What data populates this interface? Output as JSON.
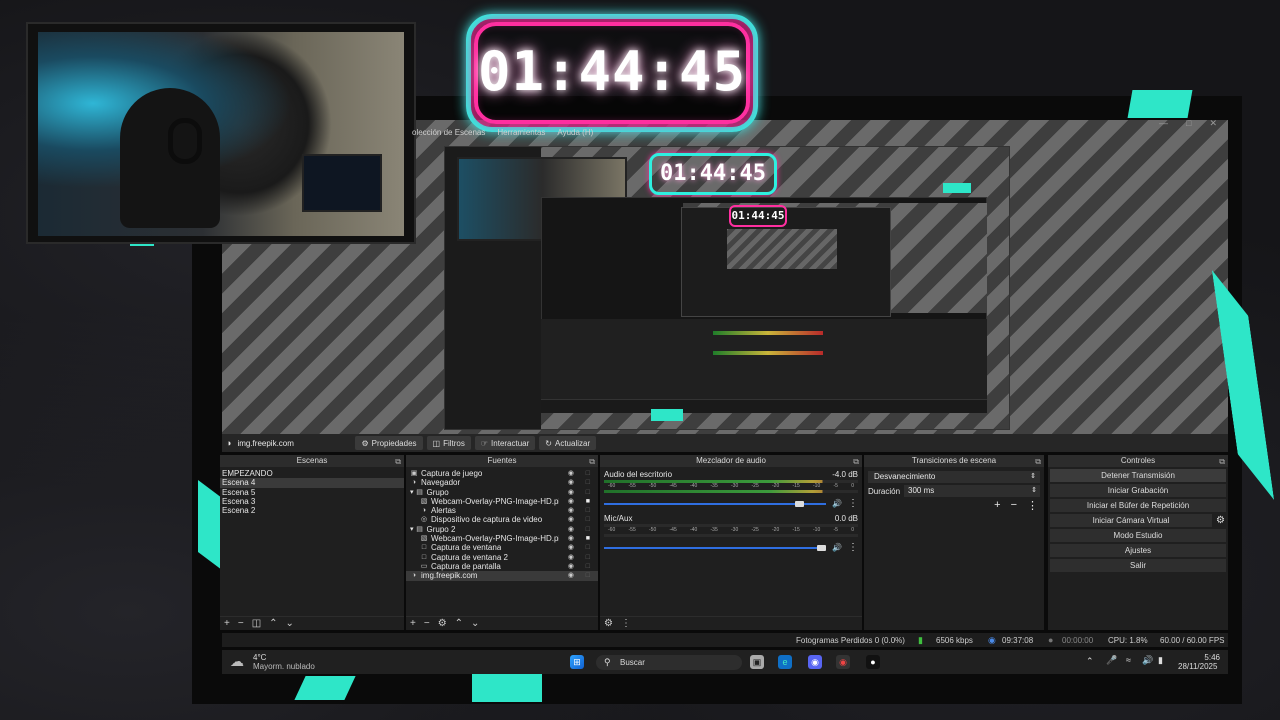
{
  "timer": {
    "text": "01:44:45"
  },
  "nested_timers": {
    "level2": "01:44:45",
    "level3": "01:44:45"
  },
  "menu": {
    "items": [
      "olección de Escenas",
      "Herramientas",
      "Ayuda (H)"
    ]
  },
  "source_toolbar": {
    "selected_source": "img.freepik.com",
    "buttons": [
      {
        "label": "Propiedades",
        "icon": "gear-icon"
      },
      {
        "label": "Filtros",
        "icon": "filter-icon"
      },
      {
        "label": "Interactuar",
        "icon": "hand-icon"
      },
      {
        "label": "Actualizar",
        "icon": "refresh-icon"
      }
    ]
  },
  "scenes": {
    "title": "Escenas",
    "items": [
      "EMPEZANDO",
      "Escena 4",
      "Escena 5",
      "Escena 3",
      "Escena 2"
    ],
    "selected_index": 1
  },
  "sources": {
    "title": "Fuentes",
    "items": [
      {
        "label": "Captura de juego",
        "indent": 0,
        "icon": "game-capture-icon",
        "lock": false
      },
      {
        "label": "Navegador",
        "indent": 0,
        "icon": "browser-icon",
        "lock": false
      },
      {
        "label": "Grupo",
        "indent": 0,
        "icon": "folder-icon",
        "expander": true,
        "lock": false
      },
      {
        "label": "Webcam-Overlay-PNG-Image-HD.pi",
        "indent": 1,
        "icon": "image-icon",
        "lock": true
      },
      {
        "label": "Alertas",
        "indent": 1,
        "icon": "browser-icon",
        "lock": false
      },
      {
        "label": "Dispositivo de captura de video",
        "indent": 1,
        "icon": "camera-icon",
        "lock": false
      },
      {
        "label": "Grupo 2",
        "indent": 0,
        "icon": "folder-icon",
        "expander": true,
        "lock": false
      },
      {
        "label": "Webcam-Overlay-PNG-Image-HD.pi",
        "indent": 1,
        "icon": "image-icon",
        "lock": true
      },
      {
        "label": "Captura de ventana",
        "indent": 1,
        "icon": "window-icon",
        "lock": false
      },
      {
        "label": "Captura de ventana 2",
        "indent": 1,
        "icon": "window-icon",
        "lock": false
      },
      {
        "label": "Captura de pantalla",
        "indent": 1,
        "icon": "monitor-icon",
        "lock": false
      },
      {
        "label": "img.freepik.com",
        "indent": 0,
        "icon": "browser-icon",
        "lock": false
      }
    ],
    "selected_index": 11
  },
  "mixer": {
    "title": "Mezclador de audio",
    "scale": [
      "-60",
      "-55",
      "-50",
      "-45",
      "-40",
      "-35",
      "-30",
      "-25",
      "-20",
      "-15",
      "-10",
      "-5",
      "0"
    ],
    "channels": [
      {
        "name": "Audio del escritorio",
        "db": "-4.0 dB",
        "fader": 0.9,
        "level": 0.86
      },
      {
        "name": "Mic/Aux",
        "db": "0.0 dB",
        "fader": 1.0,
        "level": 0.0
      }
    ]
  },
  "transitions": {
    "title": "Transiciones de escena",
    "selected": "Desvanecimiento",
    "duration_label": "Duración",
    "duration_value": "300 ms"
  },
  "controls": {
    "title": "Controles",
    "buttons": [
      "Detener Transmisión",
      "Iniciar Grabación",
      "Iniciar el Búfer de Repetición",
      "Iniciar Cámara Virtual",
      "Modo Estudio",
      "Ajustes",
      "Salir"
    ]
  },
  "status": {
    "dropped": "Fotogramas Perdidos 0 (0.0%)",
    "bitrate": "6506 kbps",
    "stream_time": "09:37:08",
    "record_time": "00:00:00",
    "cpu": "CPU: 1.8%",
    "fps": "60.00 / 60.00 FPS"
  },
  "taskbar": {
    "weather_temp": "4°C",
    "weather_desc": "Mayorm. nublado",
    "search_placeholder": "Buscar",
    "time": "5:46",
    "date": "28/11/2025"
  },
  "colors": {
    "accent_cyan": "#2ee6c8",
    "accent_pink": "#ff2fa0",
    "fader_blue": "#2f6ee0"
  }
}
